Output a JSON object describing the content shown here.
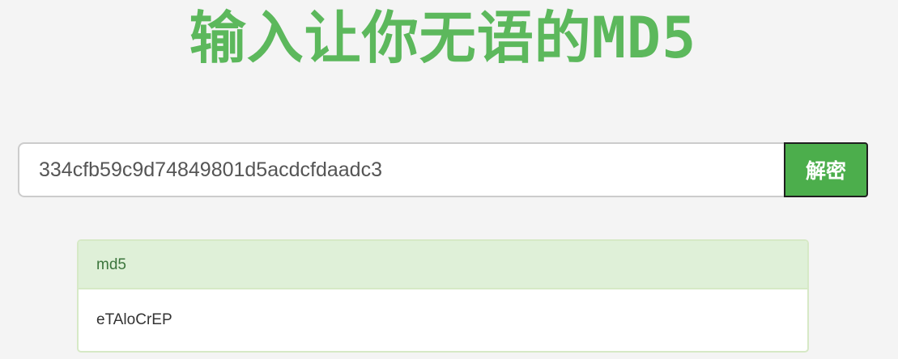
{
  "header": {
    "title": "输入让你无语的MD5"
  },
  "search": {
    "value": "334cfb59c9d74849801d5acdcfdaadc3",
    "button_label": "解密"
  },
  "result": {
    "heading": "md5",
    "value": "eTAloCrEP"
  },
  "colors": {
    "accent": "#5cb85c",
    "button": "#4cae4c",
    "panel_heading_bg": "#dff0d8",
    "panel_heading_text": "#3c763d",
    "background": "#f4f4f4"
  }
}
